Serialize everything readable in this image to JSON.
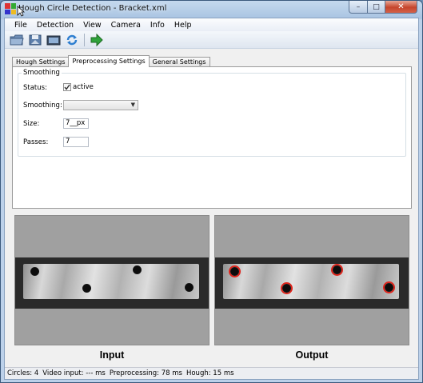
{
  "window": {
    "title": "Hough Circle Detection - Bracket.xml",
    "controls": {
      "minimize": "–",
      "maximize": "□",
      "close": "✕"
    }
  },
  "menu": [
    "File",
    "Detection",
    "View",
    "Camera",
    "Info",
    "Help"
  ],
  "toolbar": {
    "buttons": [
      "open-folder-icon",
      "save-icon",
      "camera-icon",
      "refresh-icon",
      "run-arrow-icon"
    ]
  },
  "tabs": [
    {
      "label": "Hough Settings",
      "active": false
    },
    {
      "label": "Preprocessing Settings",
      "active": true
    },
    {
      "label": "General Settings",
      "active": false
    }
  ],
  "smoothing": {
    "group_title": "Smoothing",
    "status_label": "Status:",
    "status_checked": true,
    "status_text": "active",
    "smoothing_label": "Smoothing:",
    "smoothing_value": "",
    "size_label": "Size:",
    "size_value": "7__px",
    "passes_label": "Passes:",
    "passes_value": "7"
  },
  "panes": {
    "input_caption": "Input",
    "output_caption": "Output",
    "colors": {
      "detection_ring": "#e0241b",
      "pane_bg": "#a0a0a0"
    }
  },
  "status": {
    "circles": "Circles:  4",
    "video_input": "Video input:  --- ms",
    "preprocessing": "Preprocessing:  78 ms",
    "hough": "Hough:  15 ms"
  }
}
